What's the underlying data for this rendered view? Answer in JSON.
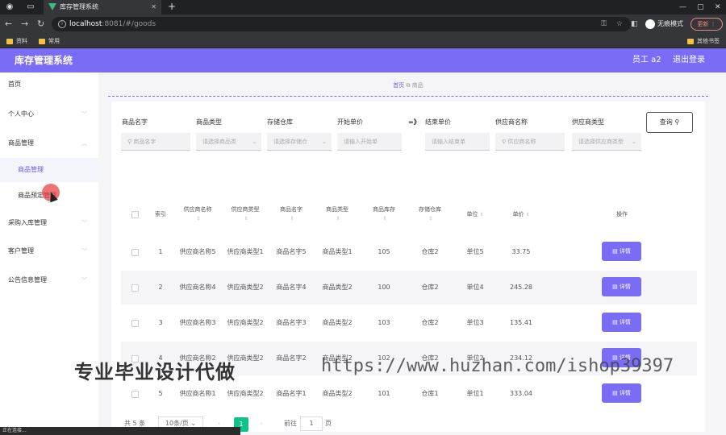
{
  "browser": {
    "tab_title": "库存管理系统",
    "url_host": "localhost",
    "url_rest": ":8081/#/goods",
    "incognito": "无痕模式",
    "update": "更新",
    "bookmarks": [
      "资料",
      "常用"
    ],
    "other_bookmarks": "其他书签"
  },
  "header": {
    "title": "库存管理系统",
    "user": "员工 a2",
    "logout": "退出登录",
    "color": "#7b6cf6"
  },
  "sidebar": {
    "items": [
      {
        "label": "首页"
      },
      {
        "label": "个人中心"
      },
      {
        "label": "商品管理"
      },
      {
        "label": "商品管理"
      },
      {
        "label": "商品预定管理"
      },
      {
        "label": "采购入库管理"
      },
      {
        "label": "客户管理"
      },
      {
        "label": "公告信息管理"
      }
    ]
  },
  "breadcrumb": {
    "home": "首页",
    "current": "商品"
  },
  "filters": {
    "goods_name": {
      "label": "商品名字",
      "placeholder": "商品名字"
    },
    "goods_type": {
      "label": "商品类型",
      "placeholder": "请选择商品类"
    },
    "warehouse": {
      "label": "存储仓库",
      "placeholder": "请选择存储仓"
    },
    "start_price": {
      "label": "开始单价",
      "placeholder": "请输入开始单"
    },
    "separator": "=》",
    "end_price": {
      "label": "结束单价",
      "placeholder": "请输入结束单"
    },
    "supplier_name": {
      "label": "供应商名称",
      "placeholder": "供应商名称"
    },
    "supplier_type": {
      "label": "供应商类型",
      "placeholder": "请选择供应商类型"
    },
    "query": "查询"
  },
  "table": {
    "headers": [
      "索引",
      "供应商名称",
      "供应商类型",
      "商品名字",
      "商品类型",
      "商品库存",
      "存储仓库",
      "单位",
      "单价",
      "操作"
    ],
    "detail_label": "详情",
    "rows": [
      {
        "idx": "1",
        "supplier": "供应商名称5",
        "stype": "供应商类型1",
        "name": "商品名字5",
        "gtype": "商品类型1",
        "stock": "105",
        "wh": "仓库2",
        "unit": "单位5",
        "price": "33.75"
      },
      {
        "idx": "2",
        "supplier": "供应商名称4",
        "stype": "供应商类型2",
        "name": "商品名字4",
        "gtype": "商品类型2",
        "stock": "100",
        "wh": "仓库2",
        "unit": "单位4",
        "price": "245.28"
      },
      {
        "idx": "3",
        "supplier": "供应商名称3",
        "stype": "供应商类型2",
        "name": "商品名字3",
        "gtype": "商品类型2",
        "stock": "103",
        "wh": "仓库2",
        "unit": "单位3",
        "price": "135.41"
      },
      {
        "idx": "4",
        "supplier": "供应商名称2",
        "stype": "供应商类型2",
        "name": "商品名字2",
        "gtype": "商品类型2",
        "stock": "102",
        "wh": "仓库2",
        "unit": "单位2",
        "price": "234.12"
      },
      {
        "idx": "5",
        "supplier": "供应商名称1",
        "stype": "供应商类型2",
        "name": "商品名字1",
        "gtype": "商品类型2",
        "stock": "101",
        "wh": "仓库1",
        "unit": "单位1",
        "price": "333.04"
      }
    ]
  },
  "pagination": {
    "total": "共 5 条",
    "page_size": "10条/页",
    "current": "1",
    "goto": "前往",
    "goto_value": "1",
    "page_suffix": "页"
  },
  "watermark": {
    "cn": "专业毕业设计代做",
    "url": "https://www.huzhan.com/ishop39397"
  },
  "status_text": "正在连接..."
}
